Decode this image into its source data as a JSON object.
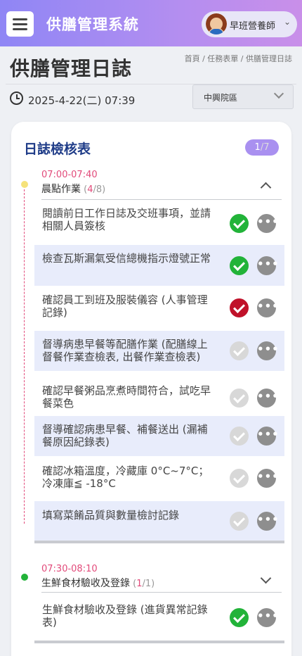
{
  "header": {
    "app_title": "供膳管理系統",
    "user_name": "早班營養師",
    "user_chevron": "⌄"
  },
  "page": {
    "title": "供膳管理日誌",
    "breadcrumb": "首頁 / 任務表單 / 供膳管理日誌",
    "datetime": "2025-4-22(二) 07:39",
    "site_select": "中興院區"
  },
  "card": {
    "title": "日誌檢核表",
    "badge_current": "1",
    "badge_total": "/7"
  },
  "sections": [
    {
      "time": "07:00-07:40",
      "name": "晨點作業",
      "done": "4",
      "total": "/8",
      "dot_color": "#f5e27a",
      "expanded": true,
      "tasks": [
        {
          "text": "閱讀前日工作日誌及交班事項，並請相關人員簽核",
          "status": "done"
        },
        {
          "text": "檢查瓦斯漏氣受信總機指示燈號正常",
          "status": "done"
        },
        {
          "text": "確認員工到班及服裝儀容 (人事管理記錄)",
          "status": "fail"
        },
        {
          "text": "督導病患早餐等配膳作業 (配膳線上督餐作業查檢表, 出餐作業查檢表)",
          "status": "pending"
        },
        {
          "text": "確認早餐粥品烹煮時間符合，試吃早餐菜色",
          "status": "pending"
        },
        {
          "text": "督導確認病患早餐、補餐送出 (漏補餐原因紀錄表)",
          "status": "pending"
        },
        {
          "text": "確認冰箱溫度，冷藏庫 0°C~7°C；冷凍庫≦ -18°C",
          "status": "pending"
        },
        {
          "text": "填寫菜餚品質與數量檢討記錄",
          "status": "pending"
        }
      ]
    },
    {
      "time": "07:30-08:10",
      "name": "生鮮食材驗收及登錄",
      "done": "1",
      "total": "/1",
      "dot_color": "#22b339",
      "expanded": false,
      "tasks": [
        {
          "text": "生鮮食材驗收及登錄 (進貨異常記錄表)",
          "status": "done"
        }
      ]
    }
  ],
  "labels": {
    "more_glyph": "•••"
  },
  "colors": {
    "done": "#22b339",
    "fail": "#c0122a",
    "pending": "#d8d8d8",
    "accent": "#1f3c88",
    "time": "#e24a7a"
  }
}
